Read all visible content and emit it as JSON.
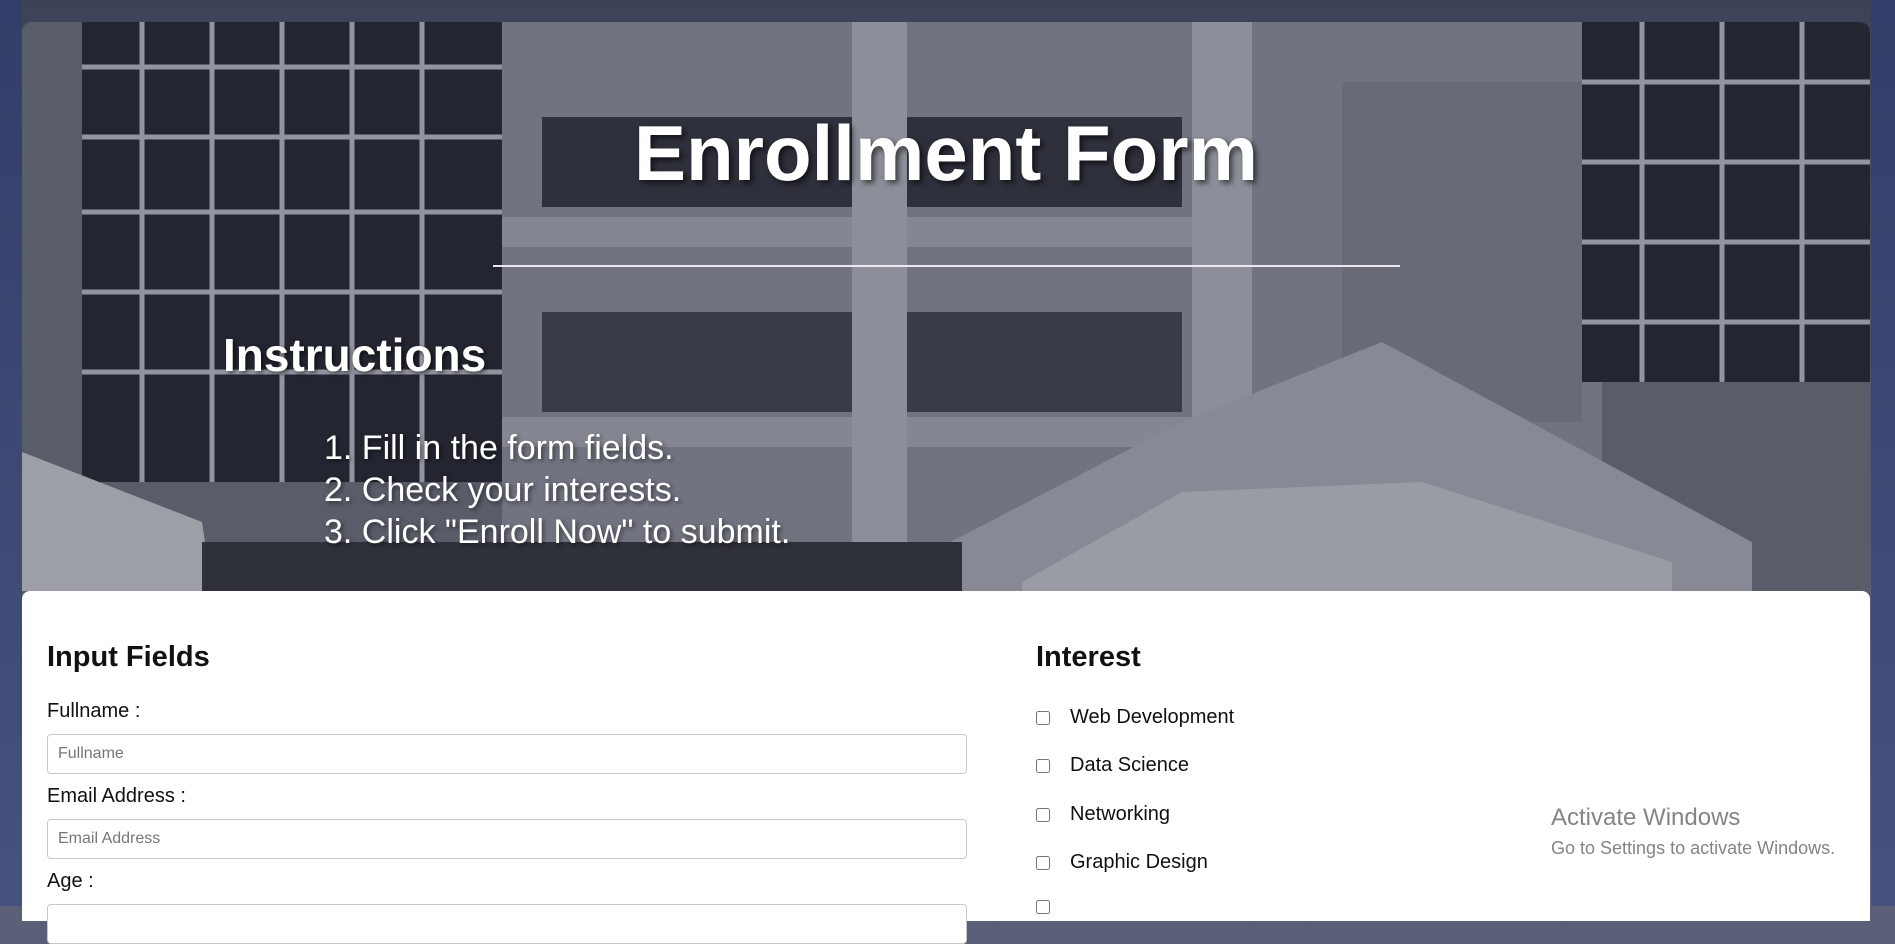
{
  "hero": {
    "title": "Enrollment Form",
    "instructions_title": "Instructions",
    "steps": [
      "1. Fill in the form fields.",
      "2. Check your interests.",
      "3. Click \"Enroll Now\" to submit."
    ]
  },
  "form": {
    "input_fields_title": "Input Fields",
    "fullname_label": "Fullname :",
    "fullname_placeholder": "Fullname",
    "email_label": "Email Address :",
    "email_placeholder": "Email Address",
    "age_label": "Age :"
  },
  "interest": {
    "title": "Interest",
    "options": [
      "Web Development",
      "Data Science",
      "Networking",
      "Graphic Design"
    ]
  },
  "watermark": {
    "line1": "Activate Windows",
    "line2": "Go to Settings to activate Windows."
  }
}
